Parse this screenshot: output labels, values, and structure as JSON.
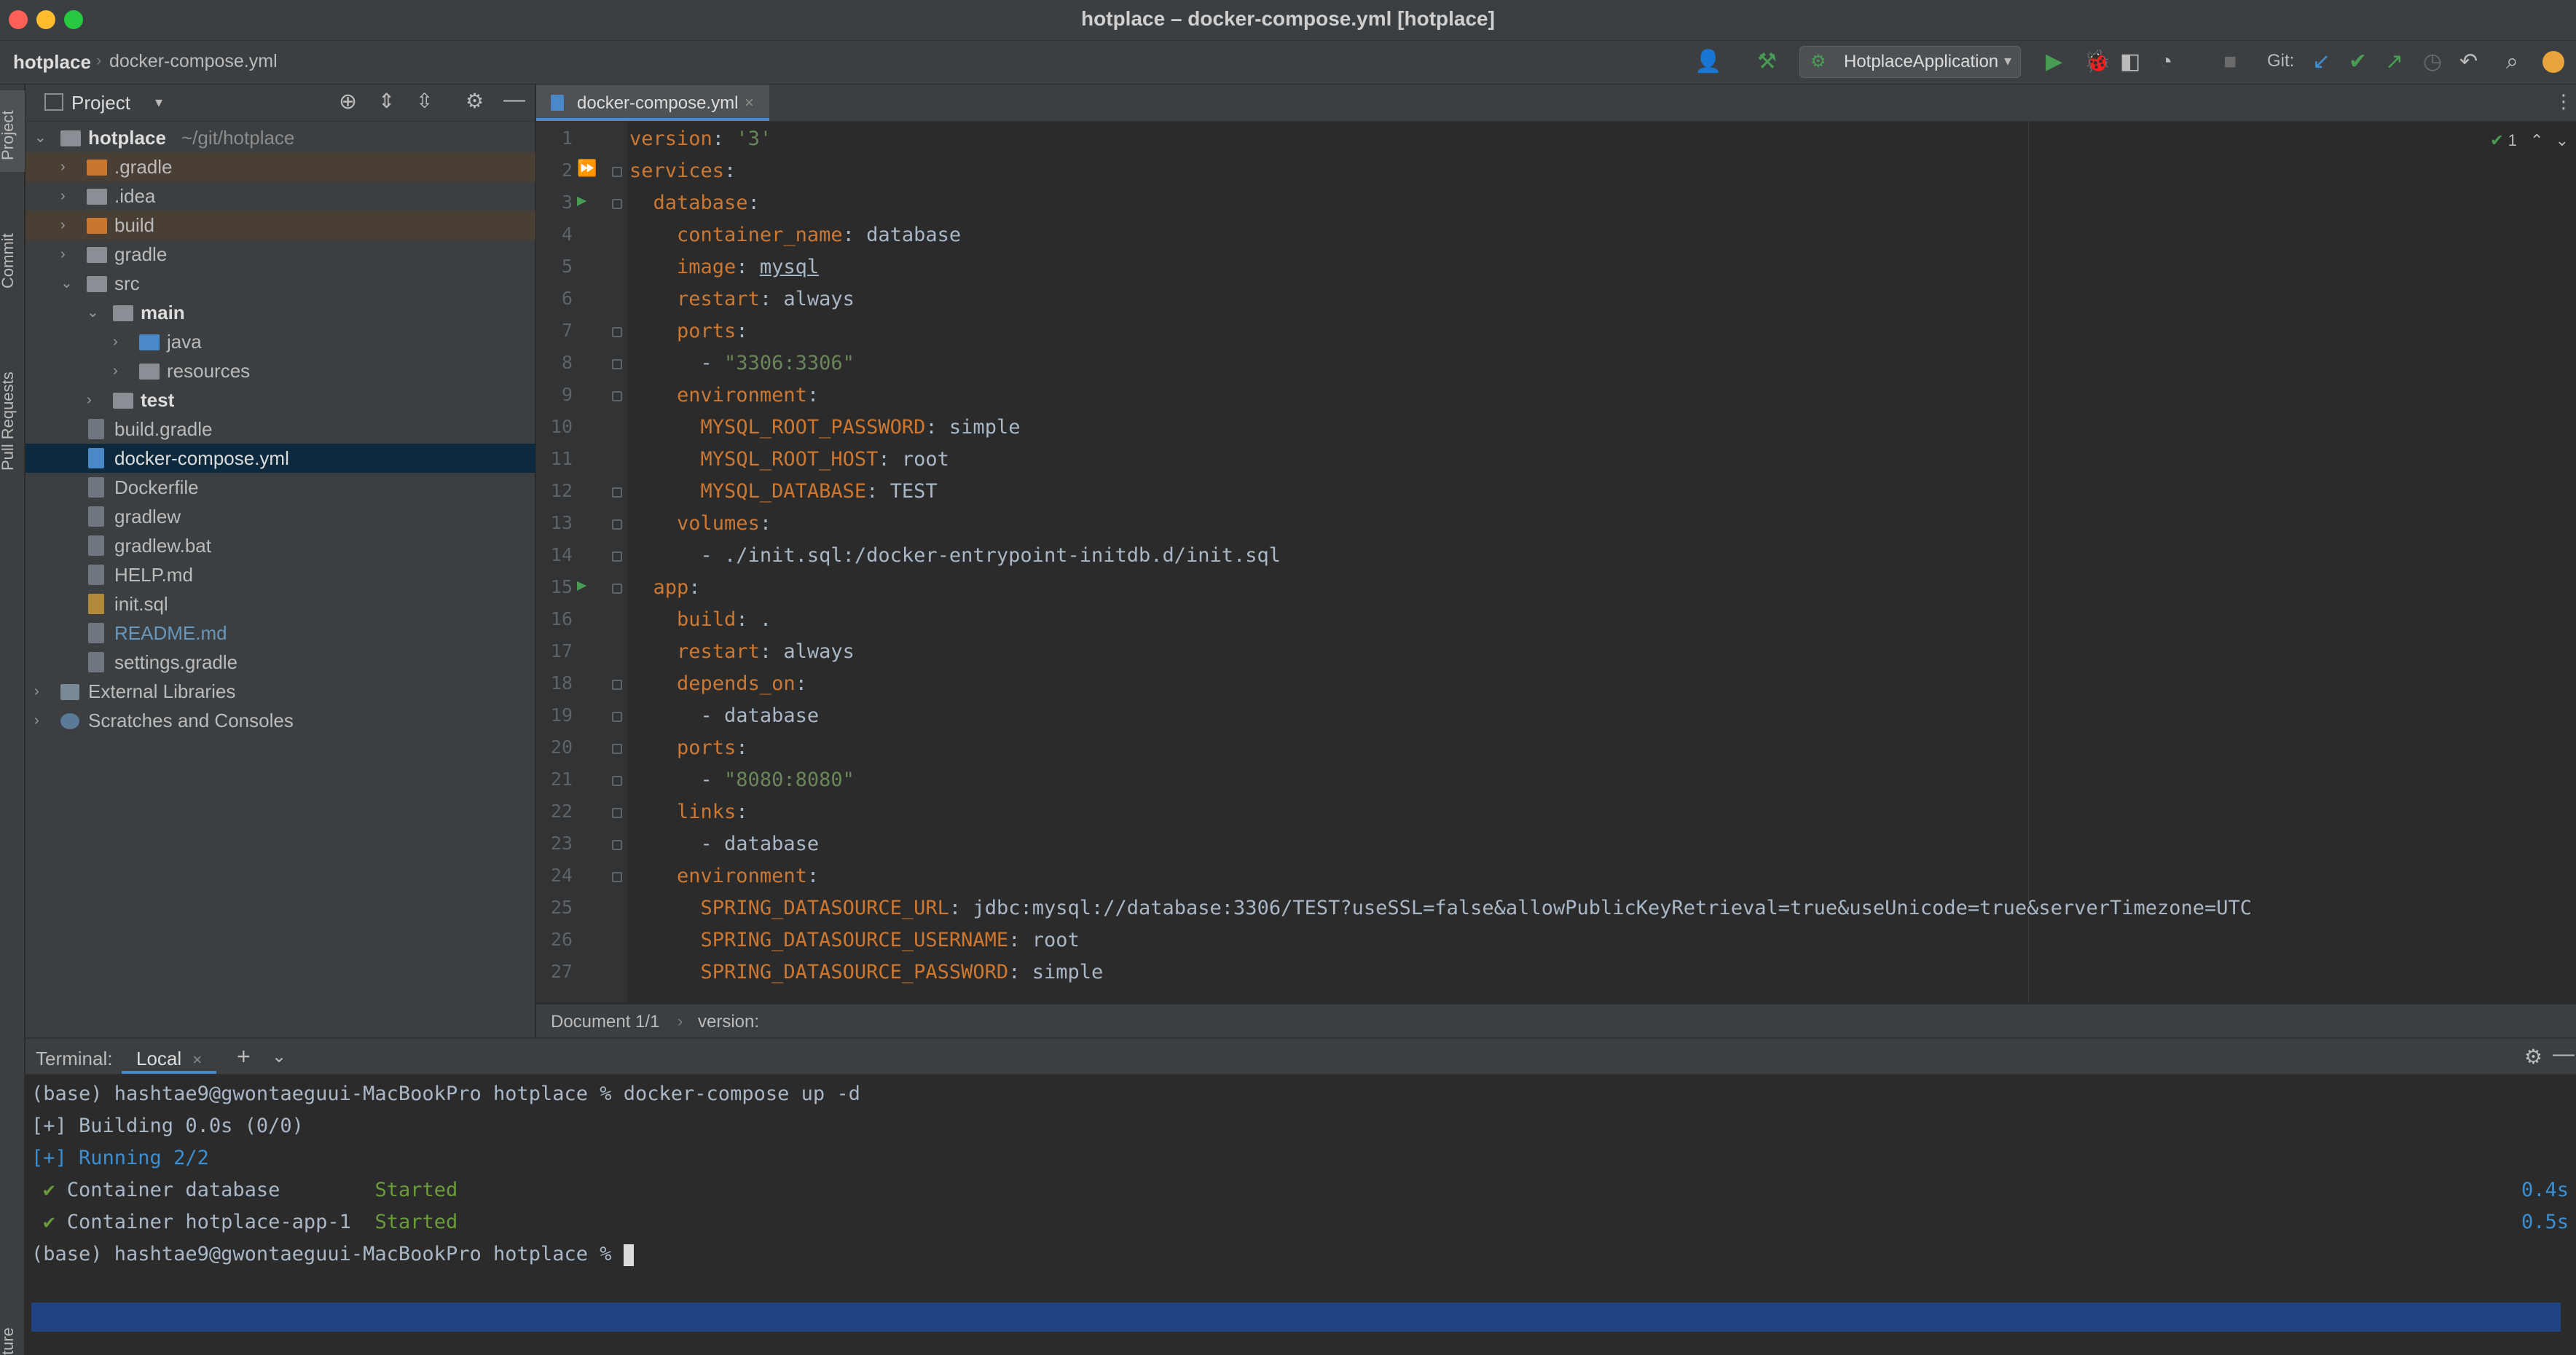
{
  "window": {
    "title": "hotplace – docker-compose.yml [hotplace]"
  },
  "navbar": {
    "project": "hotplace",
    "file": "docker-compose.yml",
    "run_config": "HotplaceApplication",
    "git_label": "Git:"
  },
  "tool_strip": {
    "items": [
      "Project",
      "Commit",
      "Pull Requests",
      "ture"
    ]
  },
  "project_panel": {
    "title": "Project",
    "root_name": "hotplace",
    "root_path": "~/git/hotplace",
    "tree": [
      {
        "label": ".gradle"
      },
      {
        "label": ".idea"
      },
      {
        "label": "build"
      },
      {
        "label": "gradle"
      },
      {
        "label": "src"
      },
      {
        "label": "main"
      },
      {
        "label": "java"
      },
      {
        "label": "resources"
      },
      {
        "label": "test"
      },
      {
        "label": "build.gradle"
      },
      {
        "label": "docker-compose.yml"
      },
      {
        "label": "Dockerfile"
      },
      {
        "label": "gradlew"
      },
      {
        "label": "gradlew.bat"
      },
      {
        "label": "HELP.md"
      },
      {
        "label": "init.sql"
      },
      {
        "label": "README.md"
      },
      {
        "label": "settings.gradle"
      },
      {
        "label": "External Libraries"
      },
      {
        "label": "Scratches and Consoles"
      }
    ]
  },
  "editor": {
    "tab": "docker-compose.yml",
    "inspections": "1",
    "breadcrumb_doc": "Document 1/1",
    "breadcrumb_item": "version:",
    "lines": [
      {
        "n": "1",
        "key": "version",
        "val": "'3'"
      },
      {
        "n": "2",
        "key": "services"
      },
      {
        "n": "3",
        "key": "database"
      },
      {
        "n": "4",
        "key": "container_name",
        "val": "database"
      },
      {
        "n": "5",
        "key": "image",
        "val": "mysql"
      },
      {
        "n": "6",
        "key": "restart",
        "val": "always"
      },
      {
        "n": "7",
        "key": "ports"
      },
      {
        "n": "8",
        "val": "\"3306:3306\""
      },
      {
        "n": "9",
        "key": "environment"
      },
      {
        "n": "10",
        "key": "MYSQL_ROOT_PASSWORD",
        "val": "simple"
      },
      {
        "n": "11",
        "key": "MYSQL_ROOT_HOST",
        "val": "root"
      },
      {
        "n": "12",
        "key": "MYSQL_DATABASE",
        "val": "TEST"
      },
      {
        "n": "13",
        "key": "volumes"
      },
      {
        "n": "14",
        "val": "./init.sql:/docker-entrypoint-initdb.d/init.sql"
      },
      {
        "n": "15",
        "key": "app"
      },
      {
        "n": "16",
        "key": "build",
        "val": "."
      },
      {
        "n": "17",
        "key": "restart",
        "val": "always"
      },
      {
        "n": "18",
        "key": "depends_on"
      },
      {
        "n": "19",
        "val": "database"
      },
      {
        "n": "20",
        "key": "ports"
      },
      {
        "n": "21",
        "val": "\"8080:8080\""
      },
      {
        "n": "22",
        "key": "links"
      },
      {
        "n": "23",
        "val": "database"
      },
      {
        "n": "24",
        "key": "environment"
      },
      {
        "n": "25",
        "key": "SPRING_DATASOURCE_URL",
        "val": "jdbc:mysql://database:3306/TEST?useSSL=false&allowPublicKeyRetrieval=true&useUnicode=true&serverTimezone=UTC"
      },
      {
        "n": "26",
        "key": "SPRING_DATASOURCE_USERNAME",
        "val": "root"
      },
      {
        "n": "27",
        "key": "SPRING_DATASOURCE_PASSWORD",
        "val": "simple"
      }
    ]
  },
  "terminal": {
    "label": "Terminal:",
    "tab": "Local",
    "lines": {
      "l1": "(base) hashtae9@gwontaeguui-MacBookPro hotplace % docker-compose up -d",
      "l2": "[+] Building 0.0s (0/0)",
      "l3": "[+] Running 2/2",
      "c1_name": "Container database",
      "c1_status": "Started",
      "c1_time": "0.4s",
      "c2_name": "Container hotplace-app-1",
      "c2_status": "Started",
      "c2_time": "0.5s",
      "prompt": "(base) hashtae9@gwontaeguui-MacBookPro hotplace % "
    }
  },
  "colors": {
    "accent": "#4a88c7",
    "yaml_key": "#cc7832",
    "yaml_string": "#6a8759",
    "terminal_cyan": "#3d8fd1",
    "terminal_green": "#6a9c3c"
  }
}
